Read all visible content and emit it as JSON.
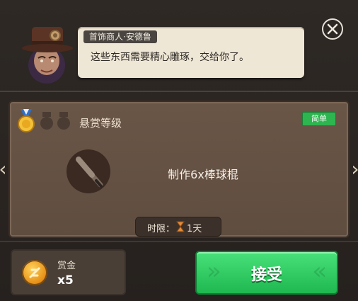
{
  "npc": {
    "name": "首饰商人·安德鲁",
    "dialogue": "这些东西需要精心雕琢，交给你了。"
  },
  "quest": {
    "rank_label": "悬赏等级",
    "rank_filled": 1,
    "rank_total": 3,
    "difficulty": "简单",
    "task": "制作6x棒球棍",
    "time_label": "时限：",
    "time_value": "1天"
  },
  "reward": {
    "label": "赏金",
    "quantity": "x5"
  },
  "actions": {
    "accept": "接受"
  },
  "icons": {
    "close": "close-icon",
    "medal": "medal-icon",
    "item": "baseball-bat-icon",
    "hourglass": "hourglass-icon",
    "coin": "coin-icon",
    "prev": "chevron-left-icon",
    "next": "chevron-right-icon"
  },
  "colors": {
    "accept_button": "#2bc85e",
    "difficulty_badge": "#2db54f",
    "panel": "#654f41"
  }
}
